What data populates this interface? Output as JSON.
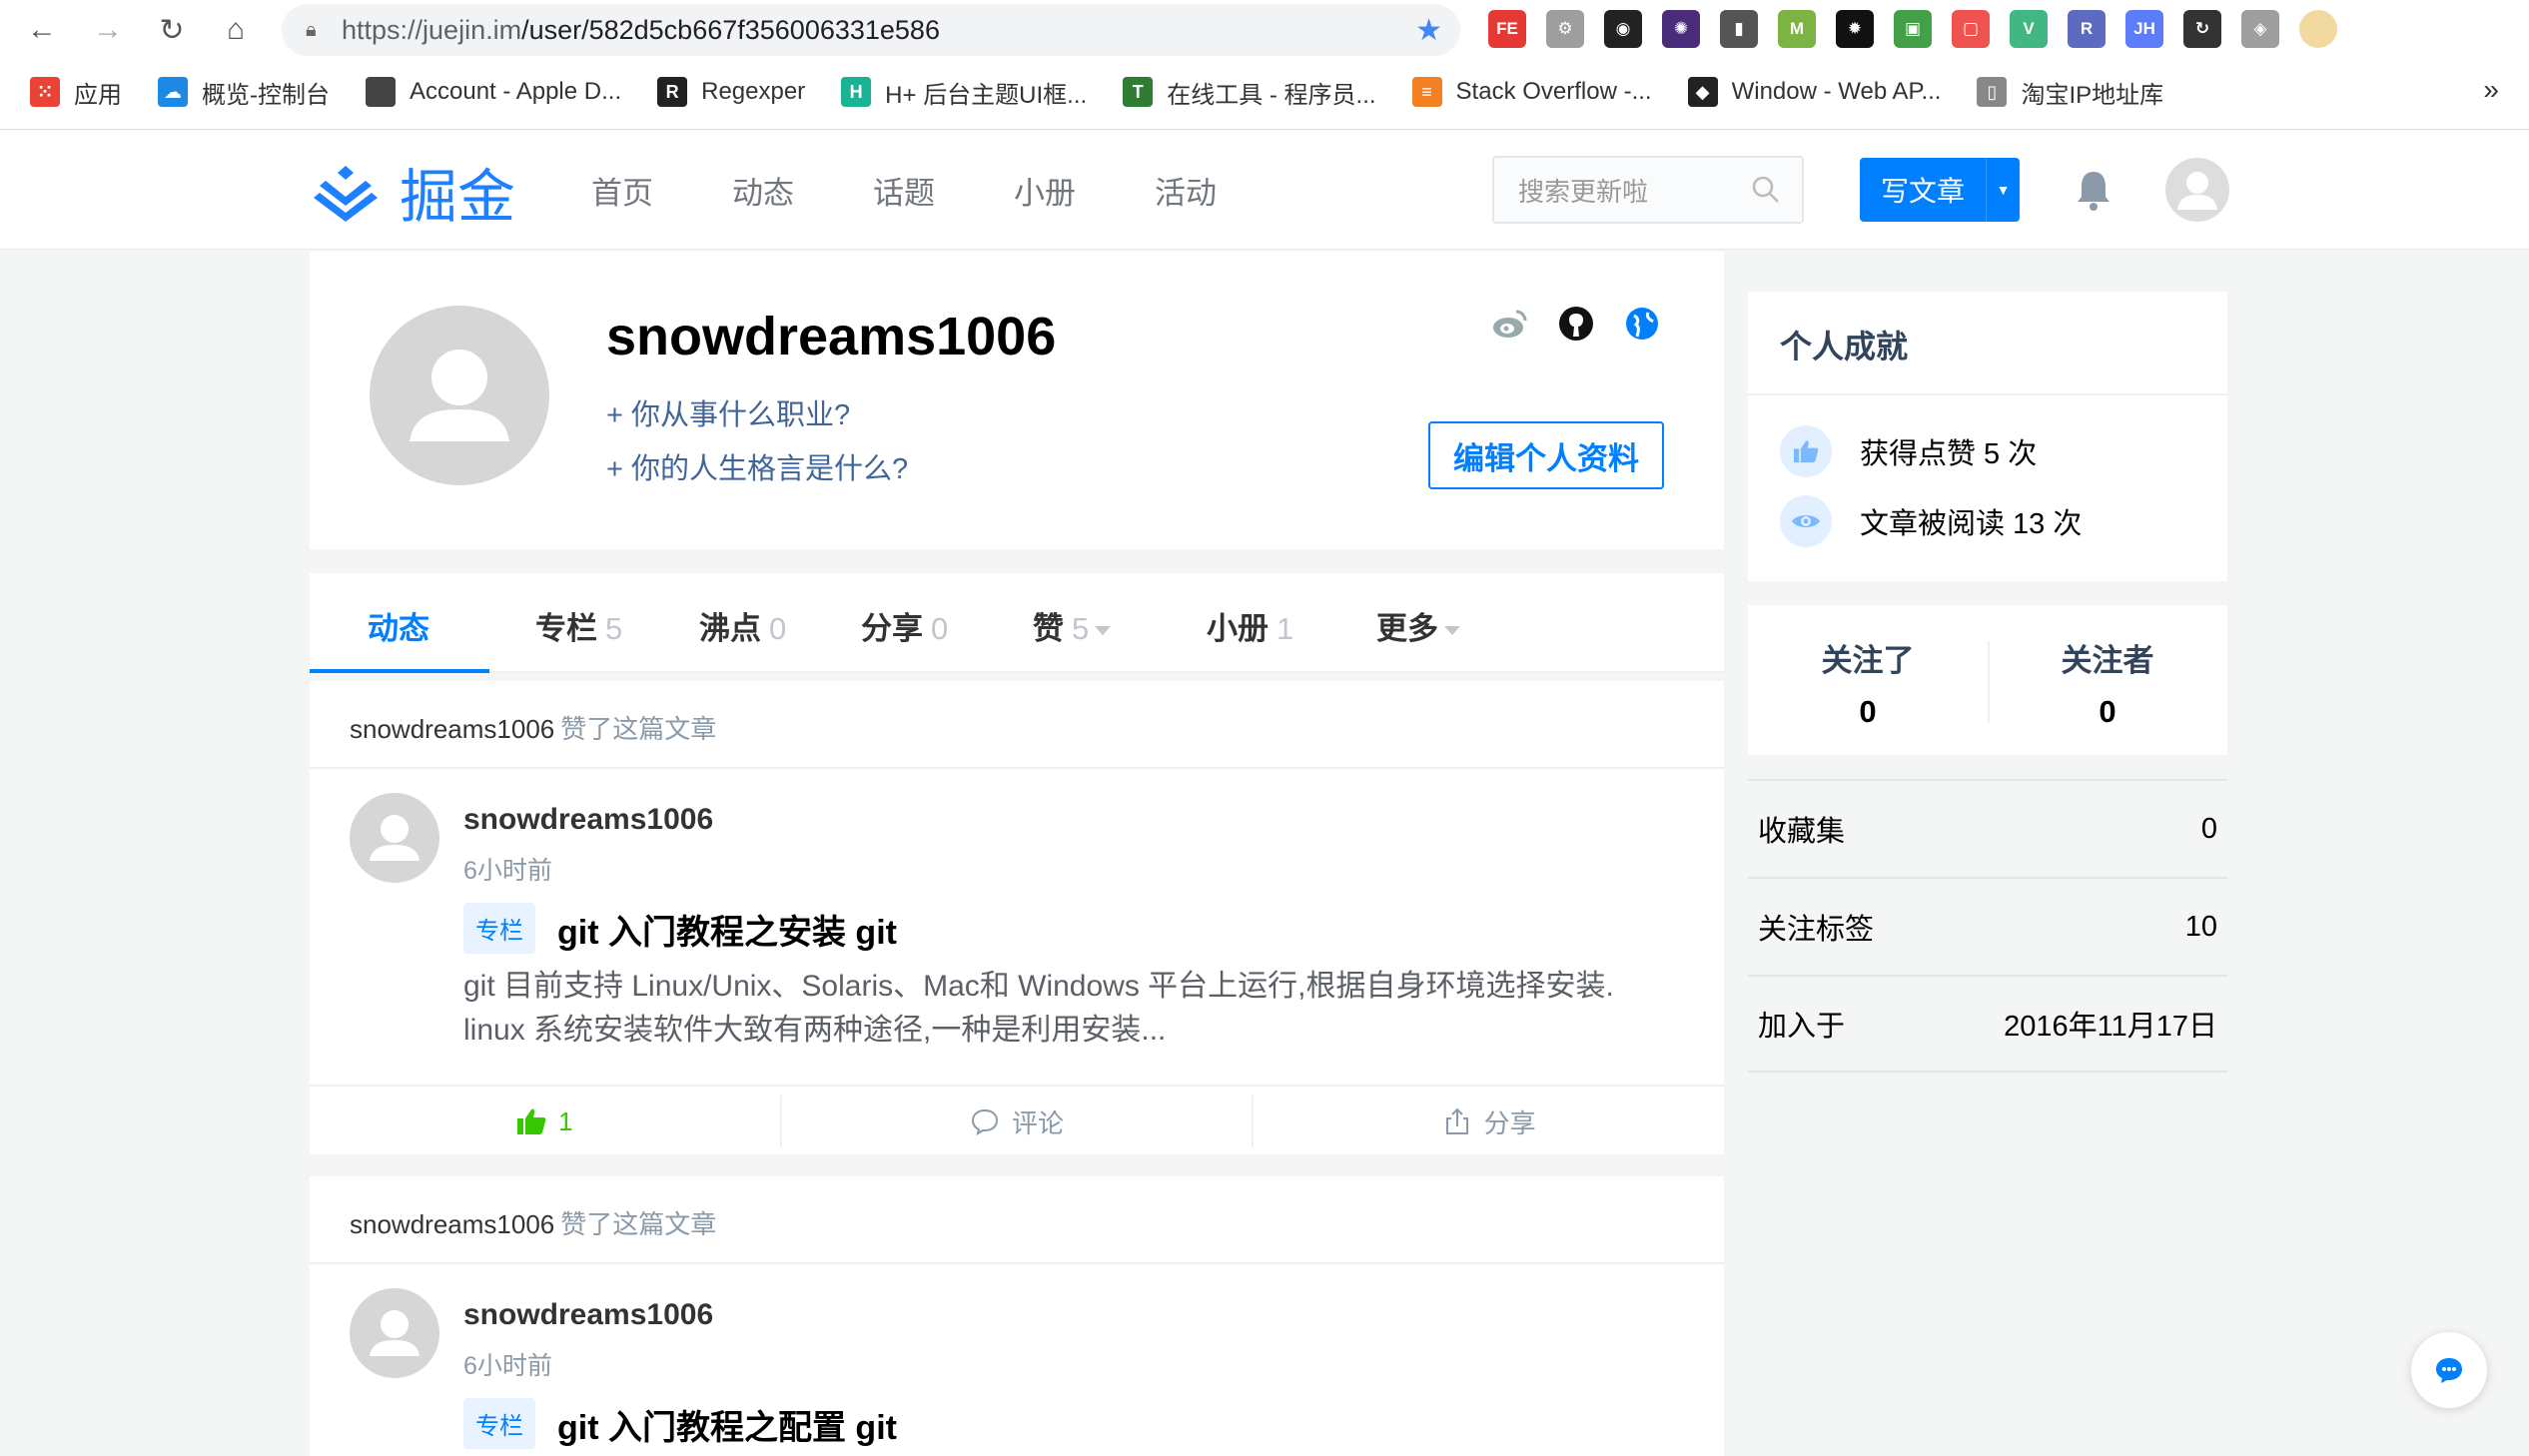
{
  "browser": {
    "url_host": "https://juejin.im",
    "url_path": "/user/582d5cb667f356006331e586",
    "extensions": [
      {
        "label": "FE",
        "color": "#e53935"
      },
      {
        "label": "⚙",
        "color": "#9e9e9e"
      },
      {
        "label": "◉",
        "color": "#222222"
      },
      {
        "label": "✺",
        "color": "#4a2c7a"
      },
      {
        "label": "▮",
        "color": "#555555"
      },
      {
        "label": "M",
        "color": "#7cb342"
      },
      {
        "label": "✹",
        "color": "#111111"
      },
      {
        "label": "▣",
        "color": "#43a047"
      },
      {
        "label": "▢",
        "color": "#ef5350"
      },
      {
        "label": "V",
        "color": "#41b883"
      },
      {
        "label": "R",
        "color": "#5c6bc0"
      },
      {
        "label": "JH",
        "color": "#5c7cfa"
      },
      {
        "label": "↻",
        "color": "#333333"
      },
      {
        "label": "◈",
        "color": "#9e9e9e"
      }
    ],
    "bookmarks": [
      {
        "label": "应用",
        "icon": "apps-grid-icon",
        "color": "#ea4335",
        "glyph": "⁙"
      },
      {
        "label": "概览-控制台",
        "icon": "cloud-icon",
        "color": "#1e88e5",
        "glyph": "☁"
      },
      {
        "label": "Account - Apple D...",
        "icon": "apple-icon",
        "color": "#444444",
        "glyph": ""
      },
      {
        "label": "Regexper",
        "icon": "regexper-icon",
        "color": "#222222",
        "glyph": "R"
      },
      {
        "label": "H+ 后台主题UI框...",
        "icon": "hplus-icon",
        "color": "#1ab394",
        "glyph": "H"
      },
      {
        "label": "在线工具 - 程序员...",
        "icon": "tool-icon",
        "color": "#2e7d32",
        "glyph": "T"
      },
      {
        "label": "Stack Overflow -...",
        "icon": "stackoverflow-icon",
        "color": "#f48024",
        "glyph": "≡"
      },
      {
        "label": "Window - Web AP...",
        "icon": "mdn-icon",
        "color": "#222222",
        "glyph": "◆"
      },
      {
        "label": "淘宝IP地址库",
        "icon": "page-icon",
        "color": "#888888",
        "glyph": "▯"
      }
    ],
    "more": "»"
  },
  "site": {
    "logo_text": "掘金",
    "nav": [
      "首页",
      "动态",
      "话题",
      "小册",
      "活动"
    ],
    "search_placeholder": "搜索更新啦",
    "write_label": "写文章",
    "brand_color": "#007fff"
  },
  "profile": {
    "username": "snowdreams1006",
    "job_prompt": "+ 你从事什么职业?",
    "motto_prompt": "+ 你的人生格言是什么?",
    "edit_label": "编辑个人资料",
    "social_icons": [
      "weibo-icon",
      "github-icon",
      "website-icon"
    ]
  },
  "tabs": [
    {
      "label": "动态",
      "count": "",
      "active": true
    },
    {
      "label": "专栏",
      "count": "5"
    },
    {
      "label": "沸点",
      "count": "0"
    },
    {
      "label": "分享",
      "count": "0"
    },
    {
      "label": "赞",
      "count": "5",
      "caret": true
    },
    {
      "label": "小册",
      "count": "1"
    },
    {
      "label": "更多",
      "count": "",
      "caret": true
    }
  ],
  "feed": [
    {
      "actor": "snowdreams1006",
      "action": "赞了这篇文章",
      "author": "snowdreams1006",
      "time": "6小时前",
      "badge": "专栏",
      "title": "git 入门教程之安装 git",
      "desc": "git 目前支持 Linux/Unix、Solaris、Mac和 Windows 平台上运行,根据自身环境选择安装. linux 系统安装软件大致有两种途径,一种是利用安装...",
      "likes": "1",
      "comment_label": "评论",
      "share_label": "分享"
    },
    {
      "actor": "snowdreams1006",
      "action": "赞了这篇文章",
      "author": "snowdreams1006",
      "time": "6小时前",
      "badge": "专栏",
      "title": "git 入门教程之配置 git"
    }
  ],
  "achievements": {
    "title": "个人成就",
    "likes": "获得点赞 5 次",
    "reads": "文章被阅读 13 次"
  },
  "follow": {
    "following_label": "关注了",
    "following": "0",
    "followers_label": "关注者",
    "followers": "0"
  },
  "stats": [
    {
      "label": "收藏集",
      "value": "0"
    },
    {
      "label": "关注标签",
      "value": "10"
    },
    {
      "label": "加入于",
      "value": "2016年11月17日"
    }
  ]
}
